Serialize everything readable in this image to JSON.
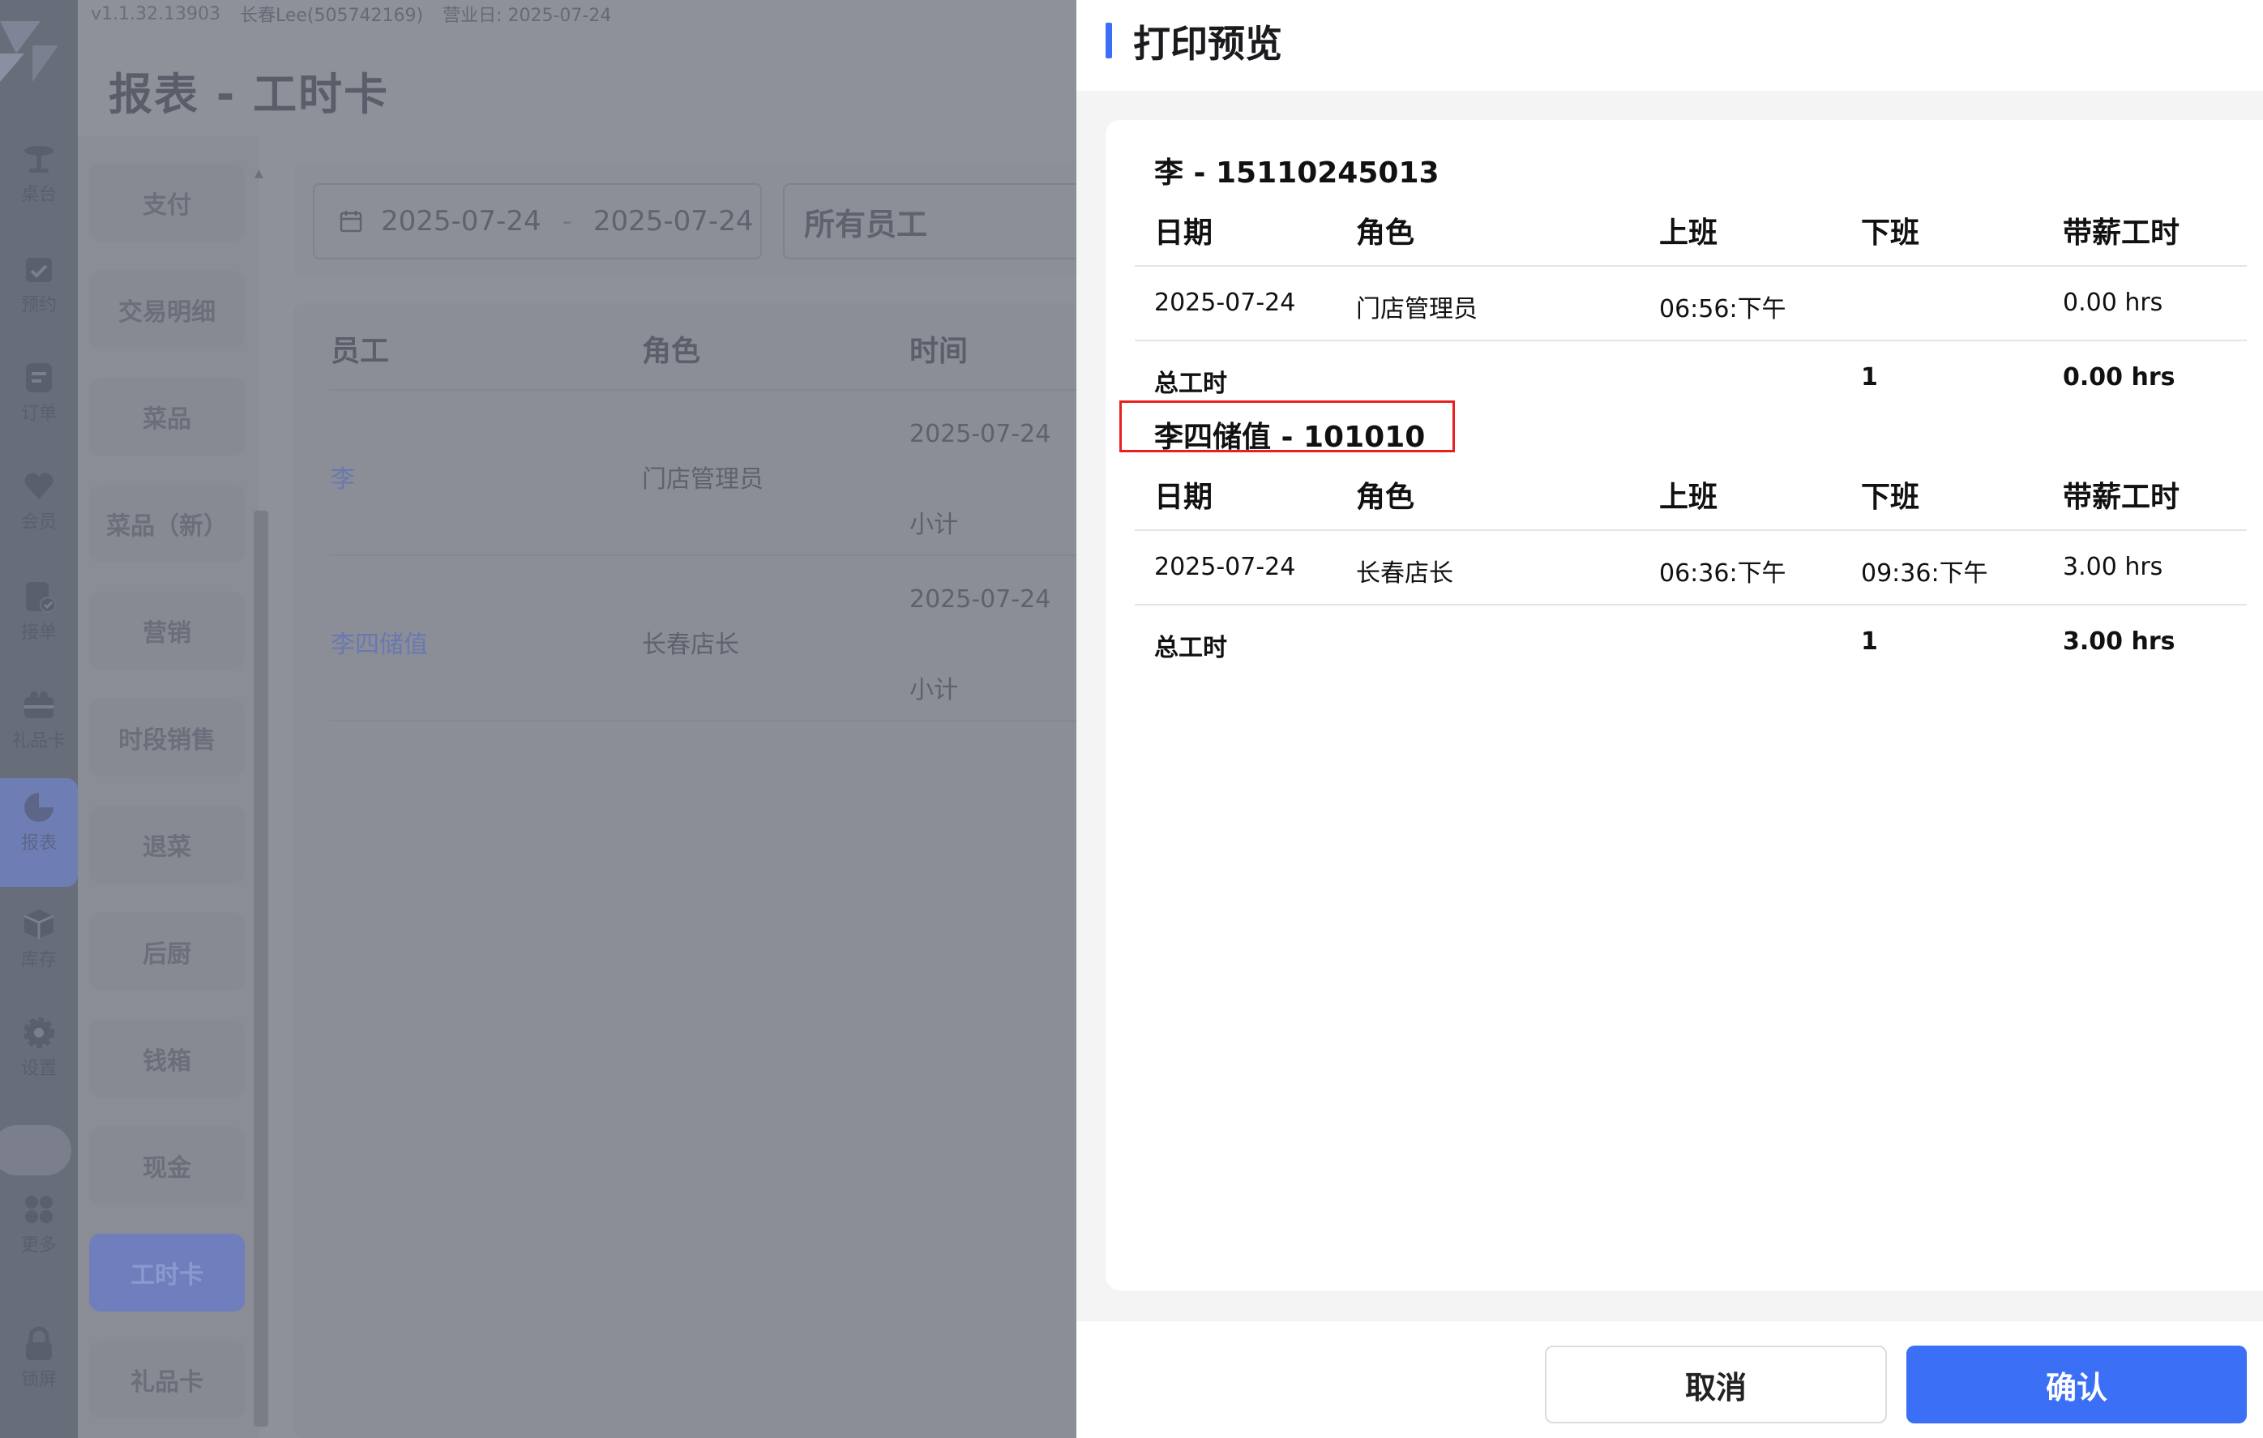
{
  "top_meta": {
    "version": "v1.1.32.13903",
    "user": "长春Lee(505742169)",
    "business_day": "营业日: 2025-07-24"
  },
  "page_title": "报表 - 工时卡",
  "nav_rail": [
    {
      "label": "桌台",
      "icon": "table-icon"
    },
    {
      "label": "预约",
      "icon": "calendar-check-icon"
    },
    {
      "label": "订单",
      "icon": "order-icon"
    },
    {
      "label": "会员",
      "icon": "heart-icon"
    },
    {
      "label": "接单",
      "icon": "accept-order-icon"
    },
    {
      "label": "礼品卡",
      "icon": "gift-card-icon"
    },
    {
      "label": "报表",
      "icon": "pie-chart-icon",
      "active": true
    },
    {
      "label": "库存",
      "icon": "box-icon"
    },
    {
      "label": "设置",
      "icon": "gear-icon"
    },
    {
      "label": "更多",
      "icon": "grid-icon"
    },
    {
      "label": "锁屏",
      "icon": "lock-icon"
    }
  ],
  "report_menu": [
    {
      "label": "支付"
    },
    {
      "label": "交易明细"
    },
    {
      "label": "菜品"
    },
    {
      "label": "菜品（新）"
    },
    {
      "label": "营销"
    },
    {
      "label": "时段销售"
    },
    {
      "label": "退菜"
    },
    {
      "label": "后厨"
    },
    {
      "label": "钱箱"
    },
    {
      "label": "现金"
    },
    {
      "label": "工时卡",
      "active": true
    },
    {
      "label": "礼品卡"
    }
  ],
  "filters": {
    "date_start": "2025-07-24",
    "date_sep": "-",
    "date_end": "2025-07-24",
    "staff": "所有员工"
  },
  "bg_table": {
    "headers": [
      "员工",
      "角色",
      "时间"
    ],
    "rows": [
      {
        "employee": "李",
        "role": "门店管理员",
        "date": "2025-07-24",
        "subtotal": "小计"
      },
      {
        "employee": "李四储值",
        "role": "长春店长",
        "date": "2025-07-24",
        "subtotal": "小计"
      }
    ]
  },
  "dialog": {
    "title": "打印预览",
    "columns": [
      "日期",
      "角色",
      "上班",
      "下班",
      "带薪工时"
    ],
    "employees": [
      {
        "title": "李 - 15110245013",
        "row": {
          "date": "2025-07-24",
          "role": "门店管理员",
          "clock_in": "06:56:下午",
          "clock_out": "",
          "paid_hours": "0.00 hrs"
        },
        "total": {
          "label": "总工时",
          "count": "1",
          "hours": "0.00 hrs"
        }
      },
      {
        "title": "李四储值 - 101010",
        "row": {
          "date": "2025-07-24",
          "role": "长春店长",
          "clock_in": "06:36:下午",
          "clock_out": "09:36:下午",
          "paid_hours": "3.00 hrs"
        },
        "total": {
          "label": "总工时",
          "count": "1",
          "hours": "3.00 hrs"
        }
      }
    ],
    "cancel_label": "取消",
    "confirm_label": "确认"
  }
}
